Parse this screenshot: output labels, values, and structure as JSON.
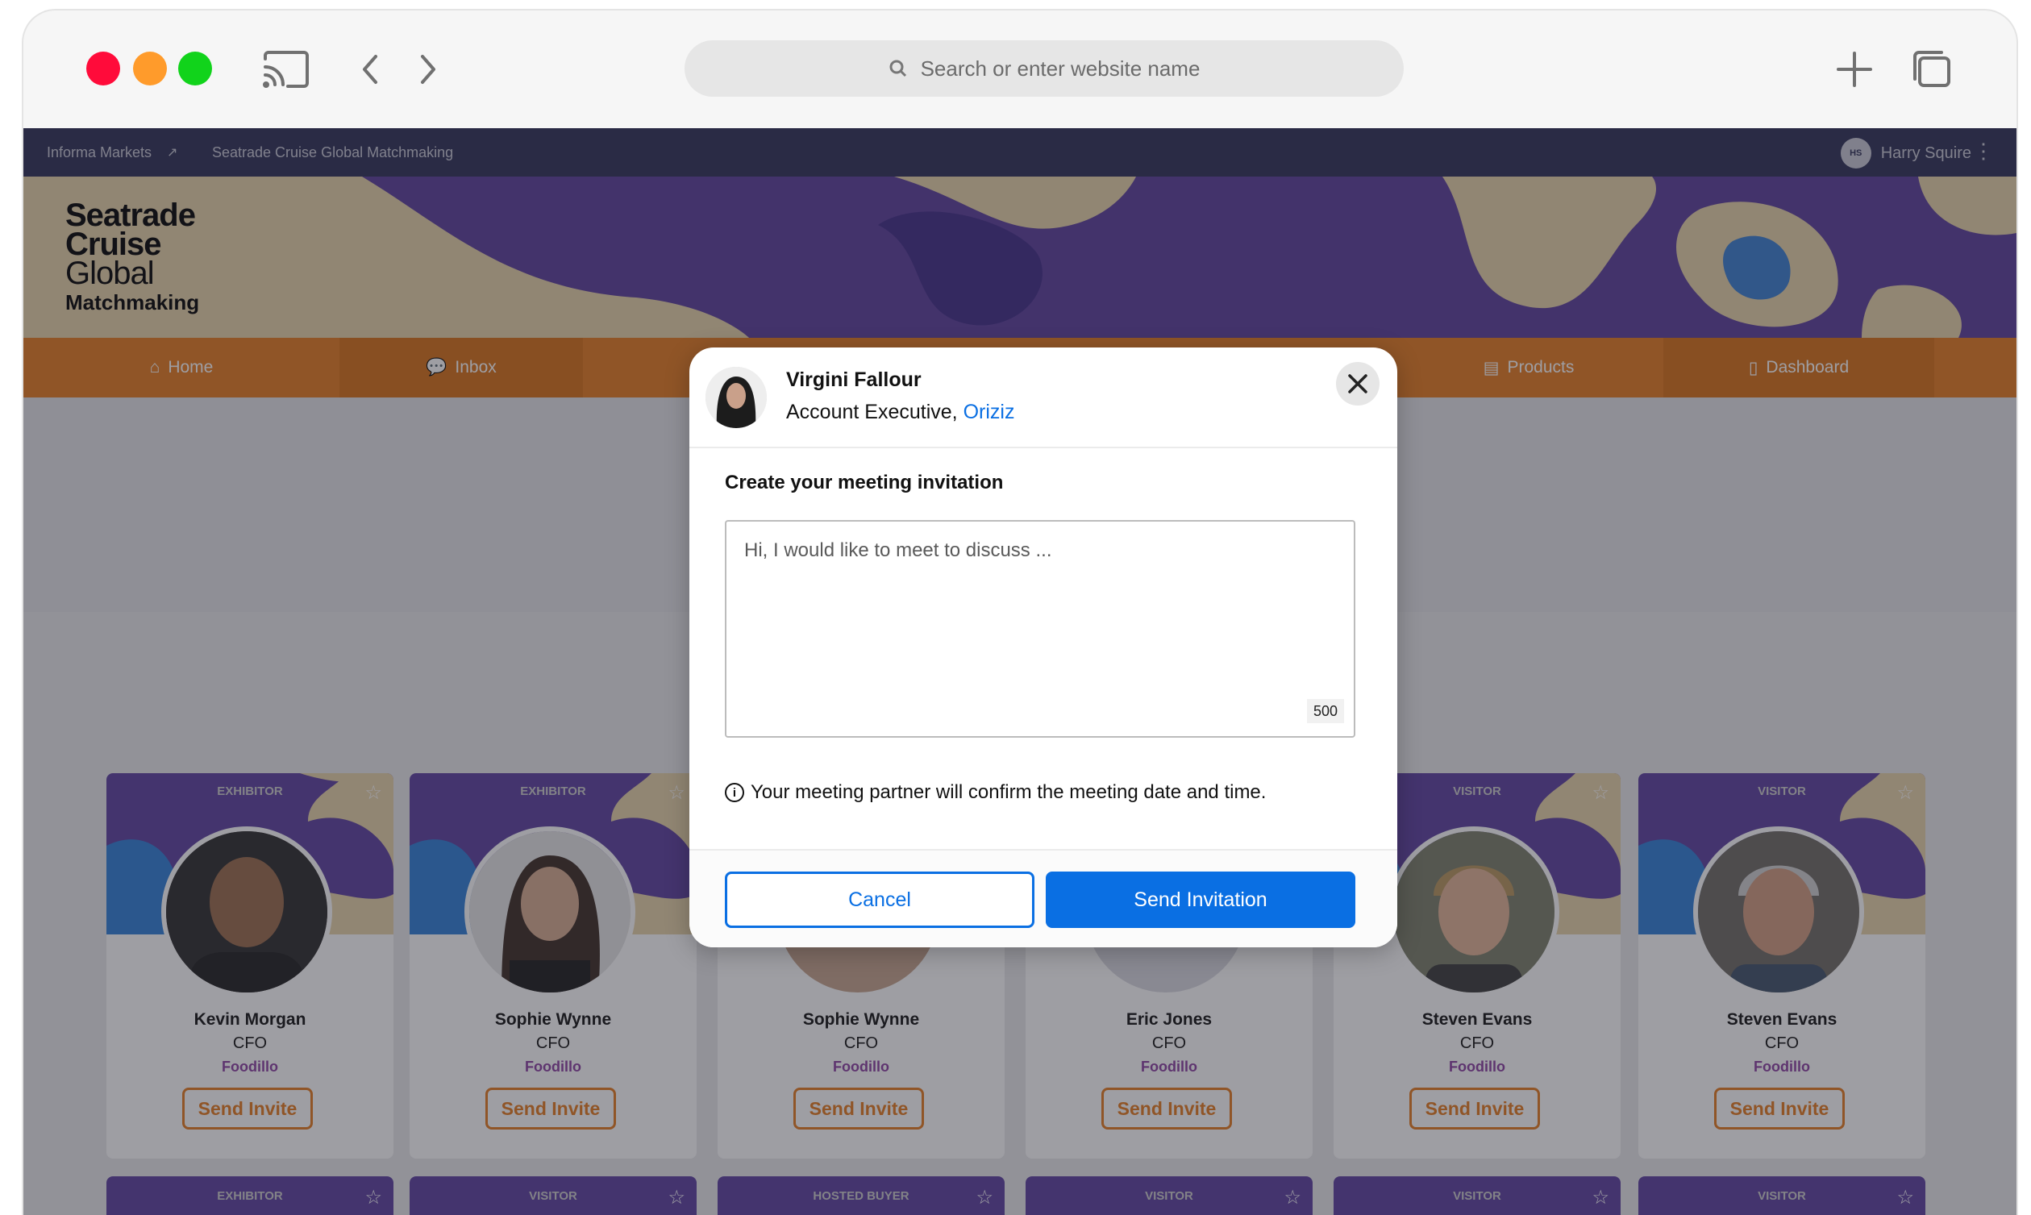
{
  "browser": {
    "url_placeholder": "Search or enter website name"
  },
  "topbar": {
    "crumb_1": "Informa Markets",
    "crumb_2": "Seatrade Cruise Global Matchmaking",
    "user_initials": "HS",
    "user_name": "Harry Squire"
  },
  "logo": {
    "line1": "Seatrade",
    "line2": "Cruise",
    "line3": "Global",
    "line4": "Matchmaking"
  },
  "nav": {
    "home": "Home",
    "inbox": "Inbox",
    "products": "Products",
    "dashboard": "Dashboard"
  },
  "cards": [
    {
      "role": "EXHIBITOR",
      "name": "Kevin Morgan",
      "title": "CFO",
      "company": "Foodillo",
      "button": "Send Invite"
    },
    {
      "role": "EXHIBITOR",
      "name": "Sophie Wynne",
      "title": "CFO",
      "company": "Foodillo",
      "button": "Send Invite"
    },
    {
      "role": "",
      "name": "Sophie Wynne",
      "title": "CFO",
      "company": "Foodillo",
      "button": "Send Invite"
    },
    {
      "role": "",
      "name": "Eric Jones",
      "title": "CFO",
      "company": "Foodillo",
      "button": "Send Invite"
    },
    {
      "role": "VISITOR",
      "name": "Steven Evans",
      "title": "CFO",
      "company": "Foodillo",
      "button": "Send Invite"
    },
    {
      "role": "VISITOR",
      "name": "Steven Evans",
      "title": "CFO",
      "company": "Foodillo",
      "button": "Send Invite"
    }
  ],
  "cards_row2": [
    {
      "role": "EXHIBITOR"
    },
    {
      "role": "VISITOR"
    },
    {
      "role": "HOSTED BUYER"
    },
    {
      "role": "VISITOR"
    },
    {
      "role": "VISITOR"
    },
    {
      "role": "VISITOR"
    }
  ],
  "modal": {
    "contact_name": "Virgini Fallour",
    "contact_title": "Account Executive,",
    "contact_company": "Oriziz",
    "heading": "Create your meeting invitation",
    "message_placeholder": "Hi, I would like to meet to discuss ...",
    "char_count": "500",
    "info_text": "Your meeting partner will confirm the meeting date and time.",
    "cancel_label": "Cancel",
    "send_label": "Send Invitation"
  },
  "colors": {
    "accent_orange": "#e57a1e",
    "primary_blue": "#0a6fe3",
    "banner_purple": "#5a3d9a"
  }
}
